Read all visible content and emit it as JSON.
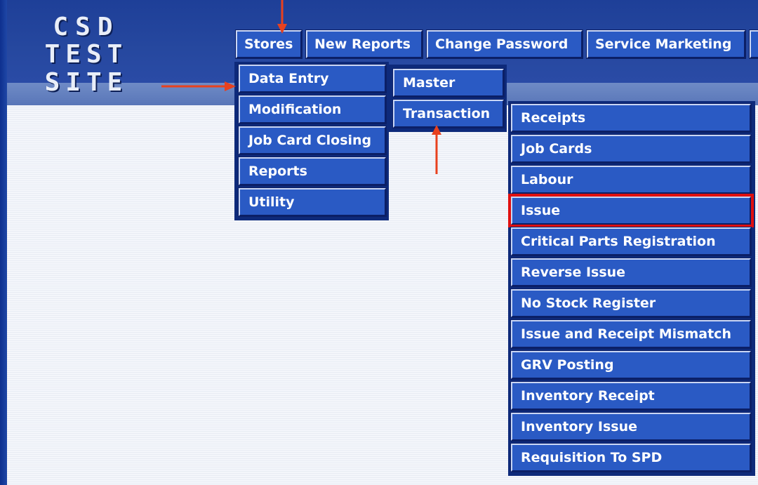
{
  "logo": {
    "line1": "CSD",
    "line2": "TEST SITE"
  },
  "topmenu": [
    "Stores",
    "New Reports",
    "Change Password",
    "Service Marketing"
  ],
  "stores_menu": [
    "Data Entry",
    "Modification",
    "Job Card Closing",
    "Reports",
    "Utility"
  ],
  "data_entry_menu": [
    "Master",
    "Transaction"
  ],
  "transaction_menu": [
    "Receipts",
    "Job Cards",
    "Labour",
    "Issue",
    "Critical Parts Registration",
    "Reverse Issue",
    "No Stock Register",
    "Issue and Receipt Mismatch",
    "GRV Posting",
    "Inventory Receipt",
    "Inventory Issue",
    "Requisition To SPD"
  ],
  "highlighted_item": "Issue",
  "colors": {
    "menu_bg": "#2a5ac4",
    "highlight": "#e01010",
    "arrow": "#e8411e"
  }
}
